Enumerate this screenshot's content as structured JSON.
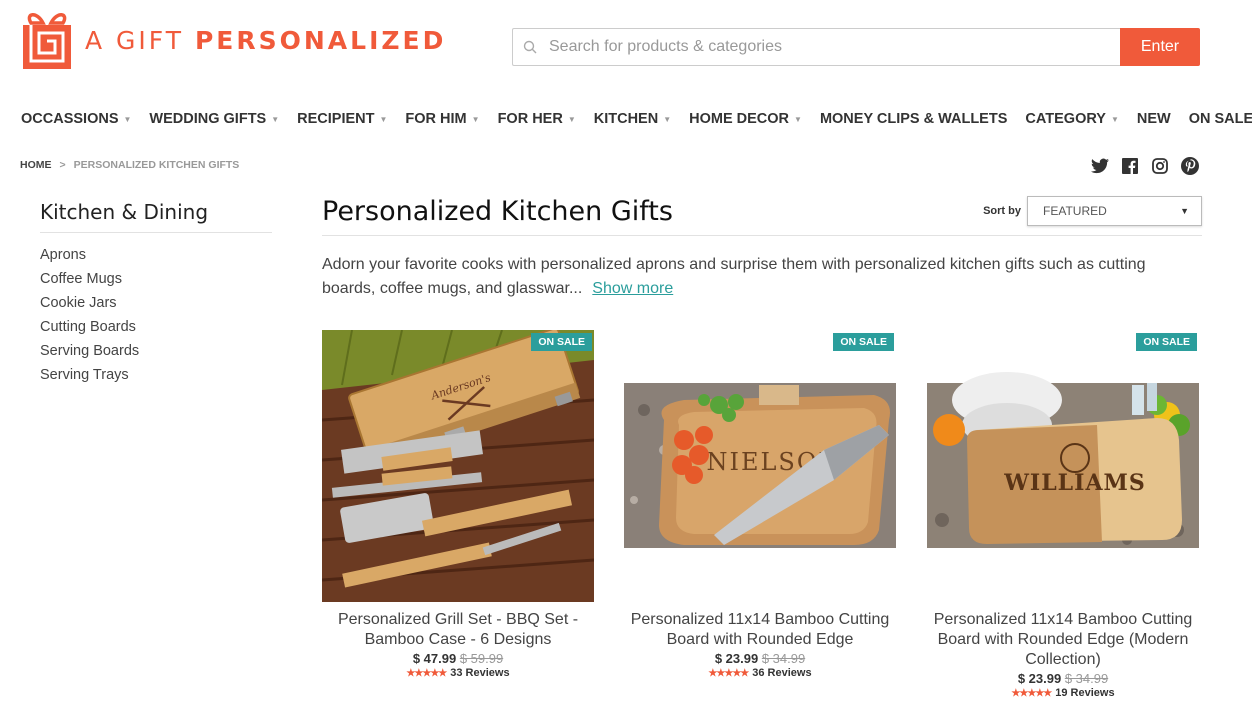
{
  "brand": {
    "name_part1": "A GIFT ",
    "name_part2": "PERSONALIZED",
    "color": "#f05a3a"
  },
  "search": {
    "placeholder": "Search for products & categories",
    "value": "",
    "button_label": "Enter",
    "icon": "search-icon"
  },
  "nav": {
    "items": [
      {
        "label": "OCCASSIONS",
        "has_dropdown": true
      },
      {
        "label": "WEDDING GIFTS",
        "has_dropdown": true
      },
      {
        "label": "RECIPIENT",
        "has_dropdown": true
      },
      {
        "label": "FOR HIM",
        "has_dropdown": true
      },
      {
        "label": "FOR HER",
        "has_dropdown": true
      },
      {
        "label": "KITCHEN",
        "has_dropdown": true
      },
      {
        "label": "HOME DECOR",
        "has_dropdown": true
      },
      {
        "label": "MONEY CLIPS & WALLETS",
        "has_dropdown": false
      },
      {
        "label": "CATEGORY",
        "has_dropdown": true
      },
      {
        "label": "NEW",
        "has_dropdown": false
      },
      {
        "label": "ON SALE",
        "has_dropdown": false
      }
    ],
    "caret": "▼"
  },
  "breadcrumb": {
    "home": "HOME",
    "separator": ">",
    "current": "PERSONALIZED KITCHEN GIFTS"
  },
  "social": [
    "twitter-icon",
    "facebook-icon",
    "instagram-icon",
    "pinterest-icon"
  ],
  "sidebar": {
    "title": "Kitchen & Dining",
    "items": [
      "Aprons",
      "Coffee Mugs",
      "Cookie Jars",
      "Cutting Boards",
      "Serving Boards",
      "Serving Trays"
    ]
  },
  "main": {
    "title": "Personalized Kitchen Gifts",
    "sort_label": "Sort by",
    "sort_value": "FEATURED",
    "description": "Adorn your favorite cooks with personalized aprons and surprise them with personalized kitchen gifts such as cutting boards, coffee mugs, and glasswar...",
    "show_more": "Show more"
  },
  "products": [
    {
      "badge": "ON SALE",
      "title": "Personalized Grill Set - BBQ Set - Bamboo Case - 6 Designs",
      "price": "$ 47.99",
      "old_price": "$ 59.99",
      "stars": "★★★★★",
      "reviews": "33 Reviews",
      "engraving": "Anderson's"
    },
    {
      "badge": "ON SALE",
      "title": "Personalized 11x14 Bamboo Cutting Board with Rounded Edge",
      "price": "$ 23.99",
      "old_price": "$ 34.99",
      "stars": "★★★★★",
      "reviews": "36 Reviews",
      "engraving": "NIELSON"
    },
    {
      "badge": "ON SALE",
      "title": "Personalized 11x14 Bamboo Cutting Board with Rounded Edge (Modern Collection)",
      "price": "$ 23.99",
      "old_price": "$ 34.99",
      "stars": "★★★★★",
      "reviews": "19 Reviews",
      "engraving": "WILLIAMS"
    }
  ],
  "colors": {
    "accent": "#f05a3a",
    "teal": "#2b9e9c",
    "star": "#f05a3a"
  }
}
